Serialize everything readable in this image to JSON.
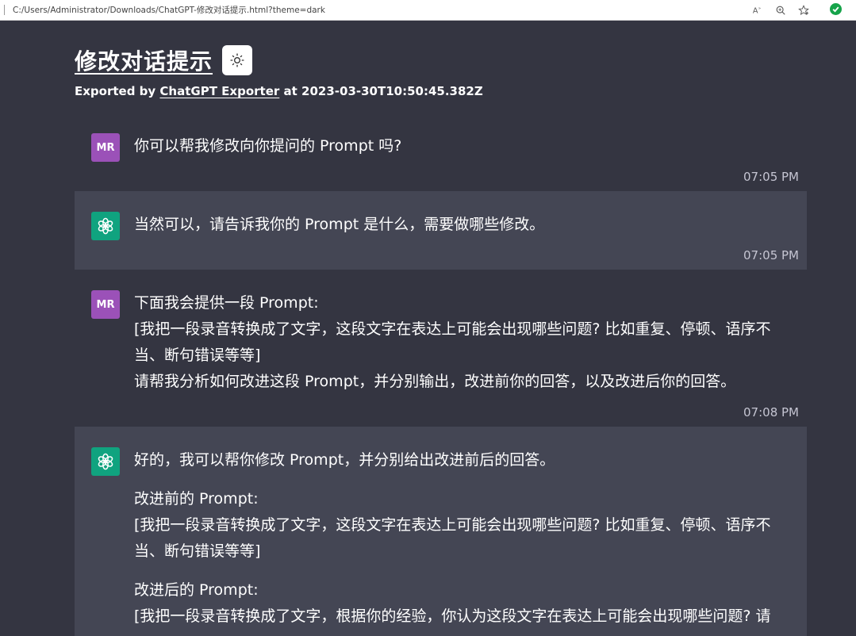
{
  "browser": {
    "url": "C:/Users/Administrator/Downloads/ChatGPT-修改对话提示.html?theme=dark"
  },
  "page": {
    "title": "修改对话提示",
    "export_prefix": "Exported by",
    "export_link": "ChatGPT Exporter",
    "export_mid": "at",
    "export_time": "2023-03-30T10:50:45.382Z"
  },
  "messages": [
    {
      "role": "user",
      "avatar": "MR",
      "paragraphs": [
        "你可以帮我修改向你提问的 Prompt 吗?"
      ],
      "time": "07:05 PM"
    },
    {
      "role": "assistant",
      "avatar": "chatgpt-logo-icon",
      "paragraphs": [
        "当然可以，请告诉我你的 Prompt 是什么，需要做哪些修改。"
      ],
      "time": "07:05 PM"
    },
    {
      "role": "user",
      "avatar": "MR",
      "lines": [
        "下面我会提供一段 Prompt:",
        "[我把一段录音转换成了文字，这段文字在表达上可能会出现哪些问题? 比如重复、停顿、语序不当、断句错误等等]",
        "请帮我分析如何改进这段 Prompt，并分别输出，改进前你的回答，以及改进后你的回答。"
      ],
      "time": "07:08 PM"
    },
    {
      "role": "assistant",
      "avatar": "chatgpt-logo-icon",
      "intro": "好的，我可以帮你修改 Prompt，并分别给出改进前后的回答。",
      "before_label": "改进前的 Prompt:",
      "before_text": "[我把一段录音转换成了文字，这段文字在表达上可能会出现哪些问题? 比如重复、停顿、语序不当、断句错误等等]",
      "after_label": "改进后的 Prompt:",
      "after_text": "[我把一段录音转换成了文字，根据你的经验，你认为这段文字在表达上可能会出现哪些问题? 请"
    }
  ],
  "colors": {
    "background": "#343541",
    "assistant_bg": "#444654",
    "user_avatar": "#9b51b8",
    "gpt_avatar": "#10a37f"
  }
}
